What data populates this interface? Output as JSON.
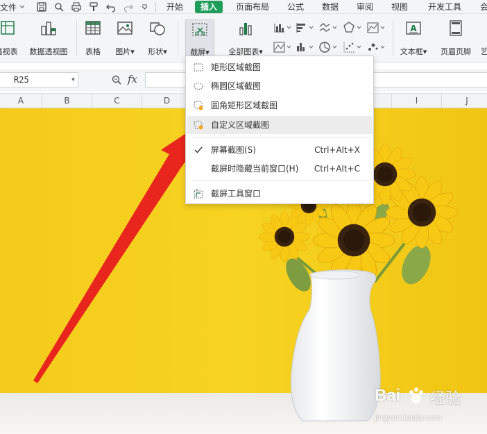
{
  "topbar": {
    "file_label": "文件",
    "tabs": [
      "开始",
      "插入",
      "页面布局",
      "公式",
      "数据",
      "审阅",
      "视图",
      "开发工具",
      "会"
    ],
    "active_tab": "插入"
  },
  "ribbon": {
    "pivot_table": "透视表",
    "pivot_chart": "数据透视图",
    "table": "表格",
    "picture": "图片",
    "shape": "形状",
    "screenshot": "截屏",
    "all_charts": "全部图表",
    "text_box": "文本框",
    "header_footer": "页眉页脚",
    "art": "艺"
  },
  "formula_bar": {
    "cell_ref": "R25",
    "fx": "fx"
  },
  "columns": [
    "A",
    "B",
    "C",
    "D",
    "I",
    "J"
  ],
  "screenshot_menu": {
    "items": [
      {
        "label": "矩形区域截图",
        "icon": "rect-dashed-icon"
      },
      {
        "label": "椭圆区域截图",
        "icon": "ellipse-dashed-icon"
      },
      {
        "label": "圆角矩形区域截图",
        "icon": "rounded-rect-icon"
      },
      {
        "label": "自定义区域截图",
        "icon": "custom-region-icon"
      }
    ],
    "screen_capture": {
      "label": "屏幕截图(S)",
      "shortcut": "Ctrl+Alt+X",
      "checked": true
    },
    "hide_window": {
      "label": "截屏时隐藏当前窗口(H)",
      "shortcut": "Ctrl+Alt+C"
    },
    "tool_window": {
      "label": "截屏工具窗口"
    }
  },
  "watermark": {
    "brand_left": "Bai",
    "brand_right": "经验",
    "url": "jingyan.baidu.com"
  },
  "colors": {
    "accent_green": "#1e9d5a",
    "wall_yellow": "#f5cd1a",
    "arrow_red": "#e8261d"
  }
}
